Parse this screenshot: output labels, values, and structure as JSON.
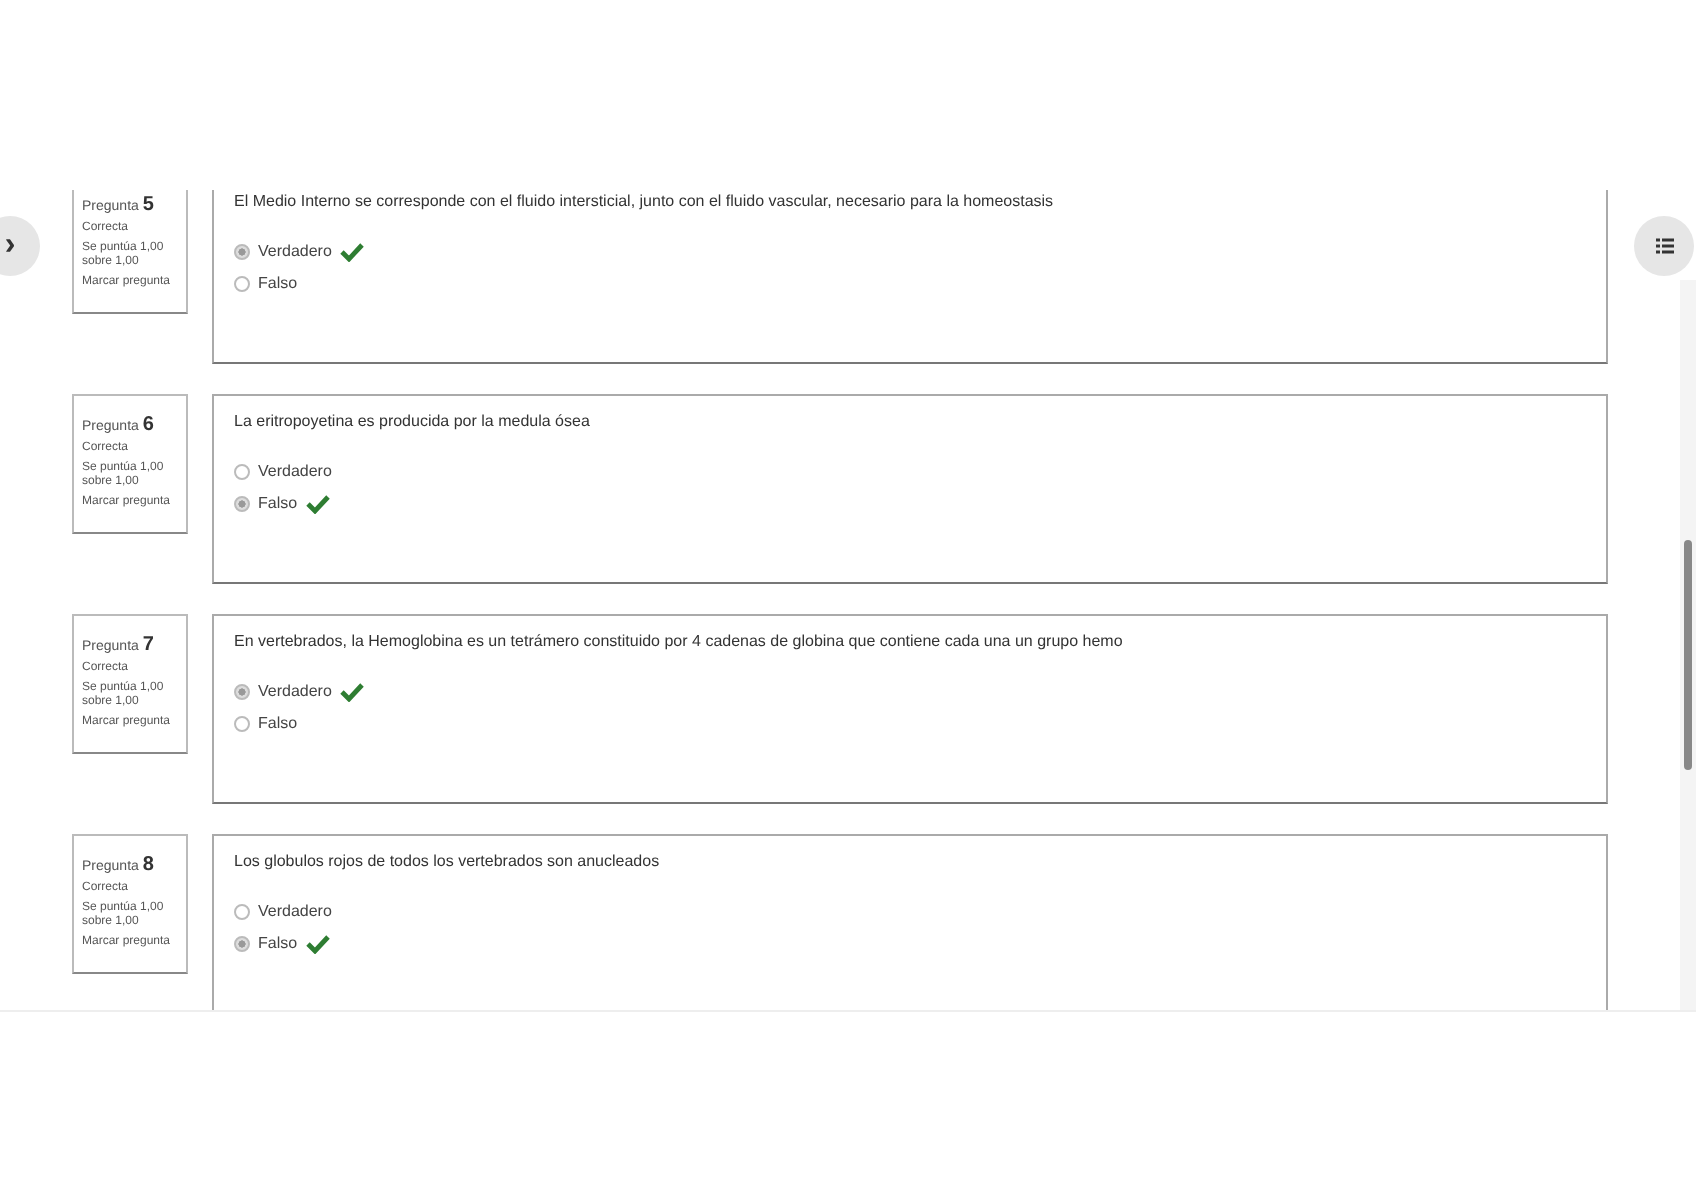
{
  "nav_button": {
    "label": "›"
  },
  "questions": [
    {
      "label": "Pregunta",
      "number": "5",
      "status": "Correcta",
      "score": "Se puntúa 1,00 sobre 1,00",
      "flag": "Marcar pregunta",
      "text": "El Medio Interno se corresponde con el fluido intersticial, junto con el fluido vascular, necesario para la homeostasis",
      "options": [
        {
          "label": "Verdadero",
          "selected": true,
          "correct": true
        },
        {
          "label": "Falso",
          "selected": false,
          "correct": false
        }
      ]
    },
    {
      "label": "Pregunta",
      "number": "6",
      "status": "Correcta",
      "score": "Se puntúa 1,00 sobre 1,00",
      "flag": "Marcar pregunta",
      "text": "La eritropoyetina es producida por la medula ósea",
      "options": [
        {
          "label": "Verdadero",
          "selected": false,
          "correct": false
        },
        {
          "label": "Falso",
          "selected": true,
          "correct": true
        }
      ]
    },
    {
      "label": "Pregunta",
      "number": "7",
      "status": "Correcta",
      "score": "Se puntúa 1,00 sobre 1,00",
      "flag": "Marcar pregunta",
      "text": "En vertebrados, la Hemoglobina es un tetrámero constituido por 4 cadenas de globina que contiene cada una un grupo hemo",
      "options": [
        {
          "label": "Verdadero",
          "selected": true,
          "correct": true
        },
        {
          "label": "Falso",
          "selected": false,
          "correct": false
        }
      ]
    },
    {
      "label": "Pregunta",
      "number": "8",
      "status": "Correcta",
      "score": "Se puntúa 1,00 sobre 1,00",
      "flag": "Marcar pregunta",
      "text": "Los globulos rojos de todos los vertebrados son anucleados",
      "options": [
        {
          "label": "Verdadero",
          "selected": false,
          "correct": false
        },
        {
          "label": "Falso",
          "selected": true,
          "correct": true
        }
      ]
    }
  ]
}
